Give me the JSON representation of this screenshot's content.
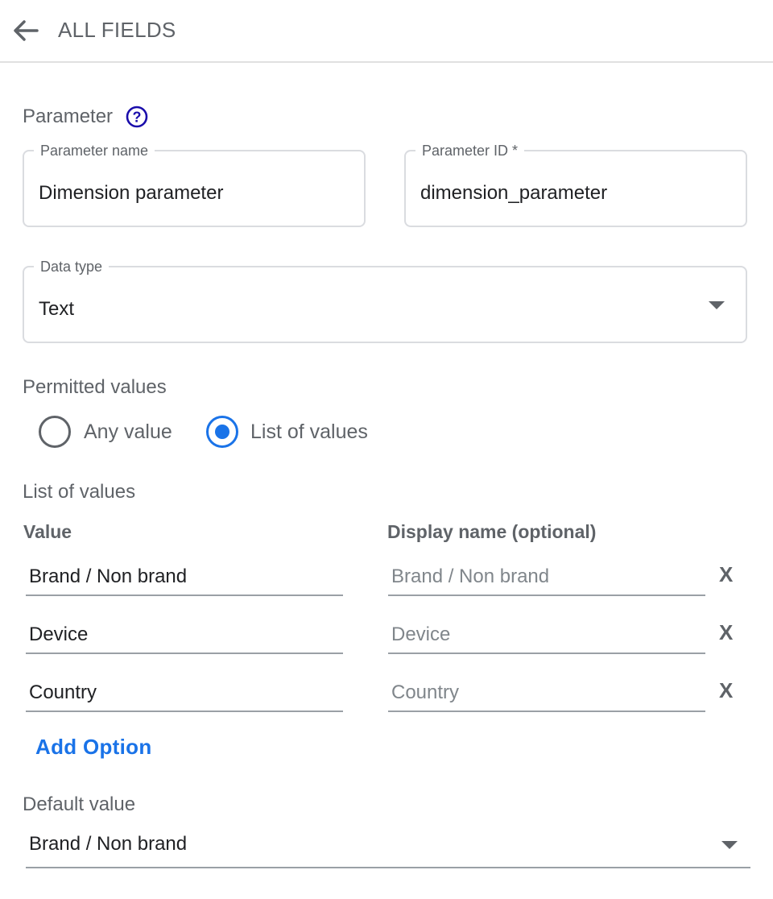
{
  "header": {
    "title": "ALL FIELDS",
    "back_icon": "arrow-left-icon"
  },
  "parameter_section": {
    "label": "Parameter",
    "help_icon": "help-circle-icon"
  },
  "parameter_name": {
    "label": "Parameter name",
    "value": "Dimension parameter"
  },
  "parameter_id": {
    "label": "Parameter ID *",
    "value": "dimension_parameter"
  },
  "data_type": {
    "label": "Data type",
    "value": "Text"
  },
  "permitted_values": {
    "label": "Permitted values",
    "options": [
      {
        "label": "Any value",
        "selected": false
      },
      {
        "label": "List of values",
        "selected": true
      }
    ]
  },
  "list_of_values": {
    "label": "List of values",
    "value_header": "Value",
    "display_header": "Display name (optional)",
    "rows": [
      {
        "value": "Brand / Non brand",
        "display_placeholder": "Brand / Non brand",
        "remove": "X"
      },
      {
        "value": "Device",
        "display_placeholder": "Device",
        "remove": "X"
      },
      {
        "value": "Country",
        "display_placeholder": "Country",
        "remove": "X"
      }
    ],
    "add_option": "Add Option"
  },
  "default_value": {
    "label": "Default value",
    "value": "Brand / Non brand"
  },
  "colors": {
    "accent": "#1a73e8",
    "help_icon": "#1a0dab",
    "text": "#202124",
    "muted": "#5f6368"
  }
}
